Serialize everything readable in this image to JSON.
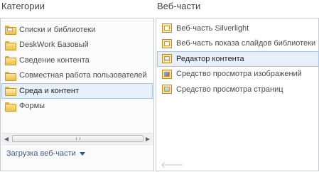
{
  "categories": {
    "title": "Категории",
    "items": [
      {
        "label": "Списки и библиотеки",
        "icon": "folder-doc-icon",
        "selected": false
      },
      {
        "label": "DeskWork Базовый",
        "icon": "folder-icon",
        "selected": false
      },
      {
        "label": "Сведение контента",
        "icon": "folder-icon",
        "selected": false
      },
      {
        "label": "Совместная работа пользователей",
        "icon": "folder-icon",
        "selected": false
      },
      {
        "label": "Среда и контент",
        "icon": "folder-open-icon",
        "selected": true
      },
      {
        "label": "Формы",
        "icon": "folder-icon",
        "selected": false
      }
    ],
    "upload_label": "Загрузка веб-части"
  },
  "webparts": {
    "title": "Веб-части",
    "items": [
      {
        "label": "Веб-часть Silverlight",
        "icon": "silverlight-webpart-icon",
        "selected": false
      },
      {
        "label": "Веб-часть показа слайдов библиотеки",
        "icon": "slideshow-webpart-icon",
        "selected": false
      },
      {
        "label": "Редактор контента",
        "icon": "content-editor-icon",
        "selected": true
      },
      {
        "label": "Средство просмотра изображений",
        "icon": "image-viewer-icon",
        "selected": false
      },
      {
        "label": "Средство просмотра страниц",
        "icon": "page-viewer-icon",
        "selected": false
      }
    ],
    "back_arrow": "🡐"
  },
  "colors": {
    "selection_bg": "#e7f0fa",
    "selection_border": "#a8c8ea",
    "link": "#3c5a85",
    "dropdown_arrow": "#1f5aa6"
  }
}
